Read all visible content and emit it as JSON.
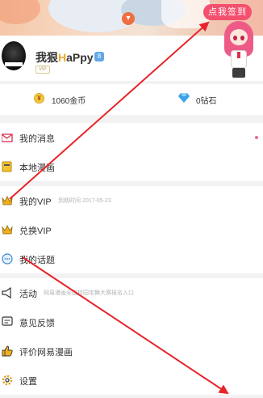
{
  "header": {
    "sign_in_label": "点我签到",
    "collapse_icon": "chevron-down-icon"
  },
  "profile": {
    "name_prefix": "我狠",
    "name_h": "H",
    "name_suffix": "aPpy",
    "level_badge": "8",
    "vip_tag": "VIP"
  },
  "wallet": {
    "coins": "1060金币",
    "diamonds": "0钻石"
  },
  "menu": {
    "messages": "我的消息",
    "local_comics": "本地漫画",
    "my_vip": "我的VIP",
    "vip_expiry": "到期时间 2017-05-23",
    "redeem_vip": "兑换VIP",
    "my_topics": "我的话题",
    "activity": "活动",
    "activity_sub": "网易漫画全国校园宅舞大赛报名入口",
    "feedback": "意见反馈",
    "rate": "评价网易漫画",
    "settings": "设置"
  },
  "colors": {
    "accent_pink": "#f3506e",
    "annotation_red": "#e8232a",
    "coin_gold": "#f7c642",
    "diamond_blue": "#3aa3e8"
  }
}
